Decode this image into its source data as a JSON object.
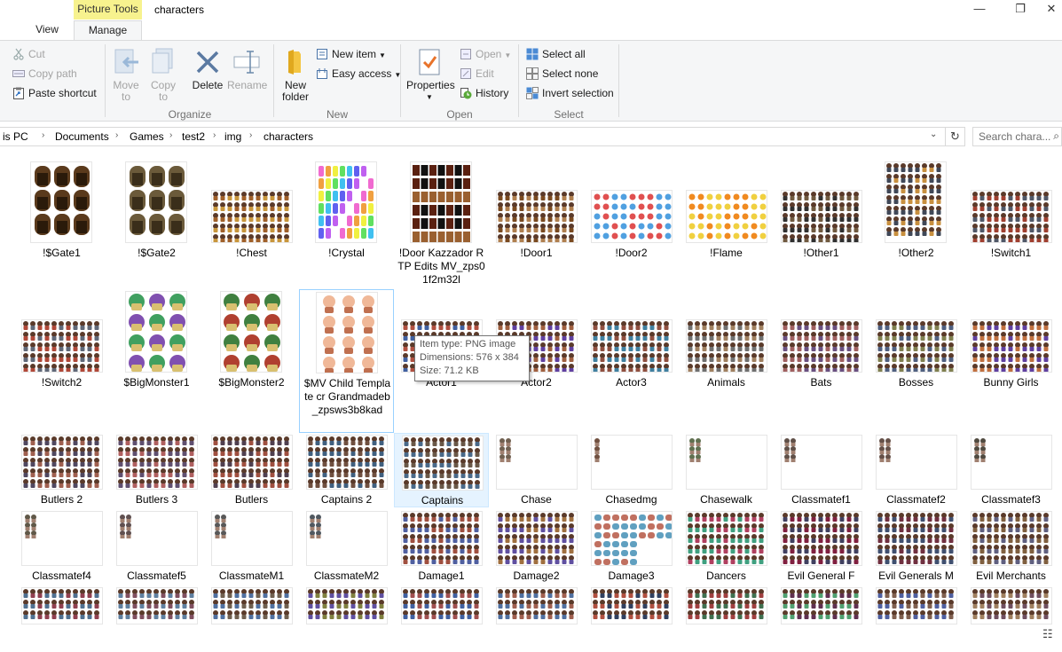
{
  "window": {
    "title": "characters",
    "context_tab_header": "Picture Tools",
    "controls": [
      "—",
      "❐",
      "✕"
    ]
  },
  "tabs": [
    {
      "label": "View"
    },
    {
      "label": "Manage"
    }
  ],
  "ribbon": {
    "clipboard": {
      "cut": "Cut",
      "copy_path": "Copy path",
      "paste_shortcut": "Paste shortcut"
    },
    "organize": {
      "label": "Organize",
      "move_to": "Move\nto",
      "copy_to": "Copy\nto",
      "delete": "Delete",
      "rename": "Rename"
    },
    "new": {
      "label": "New",
      "new_folder": "New\nfolder",
      "new_item": "New item",
      "easy_access": "Easy access"
    },
    "open": {
      "label": "Open",
      "properties": "Properties",
      "open": "Open",
      "edit": "Edit",
      "history": "History"
    },
    "select": {
      "label": "Select",
      "select_all": "Select all",
      "select_none": "Select none",
      "invert": "Invert selection"
    }
  },
  "address": {
    "crumbs": [
      "is PC",
      "Documents",
      "Games",
      "test2",
      "img",
      "characters"
    ],
    "search_placeholder": "Search chara..."
  },
  "tooltip": {
    "type": "Item type: PNG image",
    "dimensions": "Dimensions: 576 x 384",
    "size": "Size: 71.2 KB"
  },
  "files": [
    {
      "name": "!$Gate1",
      "style": "gate",
      "c1": "#5a3a1c",
      "c2": "#2a1a0a"
    },
    {
      "name": "!$Gate2",
      "style": "gate",
      "c1": "#6b5a3a",
      "c2": "#3a2e1a"
    },
    {
      "name": "!Chest",
      "style": "grid",
      "c1": "#a0602a",
      "c2": "#c8963c"
    },
    {
      "name": "!Crystal",
      "style": "crystal",
      "c1": "#f06ad0",
      "c2": "#6ad0f0"
    },
    {
      "name": "!Door Kazzador RTP Edits MV_zps01f2m32l",
      "style": "door",
      "c1": "#5a2010",
      "c2": "#9a6030"
    },
    {
      "name": "!Door1",
      "style": "grid",
      "c1": "#7a4a20",
      "c2": "#b08050"
    },
    {
      "name": "!Door2",
      "style": "dots",
      "c1": "#e05050",
      "c2": "#50a0e0"
    },
    {
      "name": "!Flame",
      "style": "dots",
      "c1": "#f08a20",
      "c2": "#f0d040"
    },
    {
      "name": "!Other1",
      "style": "grid",
      "c1": "#705a40",
      "c2": "#303030"
    },
    {
      "name": "!Other2",
      "style": "grid",
      "c1": "#c89040",
      "c2": "#404858"
    },
    {
      "name": "!Switch1",
      "style": "grid",
      "c1": "#505868",
      "c2": "#a04030"
    },
    {
      "name": "!Switch2",
      "style": "grid",
      "c1": "#606878",
      "c2": "#b04838"
    },
    {
      "name": "$BigMonster1",
      "style": "monster",
      "c1": "#8050b0",
      "c2": "#40a060"
    },
    {
      "name": "$BigMonster2",
      "style": "monster",
      "c1": "#b04030",
      "c2": "#408040"
    },
    {
      "name": "$MV Child Template cr Grandmadeb_zpsws3b8kad",
      "style": "child",
      "c1": "#e0a080",
      "c2": "#c07050"
    },
    {
      "name": "Actor1",
      "style": "sprites",
      "c1": "#b05040",
      "c2": "#4060a0"
    },
    {
      "name": "Actor2",
      "style": "sprites",
      "c1": "#a06040",
      "c2": "#6040a0"
    },
    {
      "name": "Actor3",
      "style": "sprites",
      "c1": "#905040",
      "c2": "#4080a0"
    },
    {
      "name": "Animals",
      "style": "sprites",
      "c1": "#a08060",
      "c2": "#707070"
    },
    {
      "name": "Bats",
      "style": "sprites",
      "c1": "#6a5080",
      "c2": "#a06060"
    },
    {
      "name": "Bosses",
      "style": "sprites",
      "c1": "#506080",
      "c2": "#808050"
    },
    {
      "name": "Bunny Girls",
      "style": "sprites",
      "c1": "#6040a0",
      "c2": "#c07040"
    },
    {
      "name": "Butlers 2",
      "style": "sprites",
      "c1": "#504860",
      "c2": "#a06050"
    },
    {
      "name": "Butlers 3",
      "style": "sprites",
      "c1": "#605070",
      "c2": "#b06060"
    },
    {
      "name": "Butlers",
      "style": "sprites",
      "c1": "#504050",
      "c2": "#a05040"
    },
    {
      "name": "Captains 2",
      "style": "sprites",
      "c1": "#705040",
      "c2": "#406080"
    },
    {
      "name": "Captains",
      "style": "sprites",
      "c1": "#6a5848",
      "c2": "#4a6a8a"
    },
    {
      "name": "Chase",
      "style": "sparse",
      "c1": "#706050",
      "c2": "#a08070"
    },
    {
      "name": "Chasedmg",
      "style": "sparse1",
      "c1": "#705040",
      "c2": "#a08070"
    },
    {
      "name": "Chasewalk",
      "style": "sparse",
      "c1": "#607050",
      "c2": "#a08070"
    },
    {
      "name": "Classmatef1",
      "style": "sparse",
      "c1": "#605048",
      "c2": "#a08070"
    },
    {
      "name": "Classmatef2",
      "style": "sparse",
      "c1": "#655048",
      "c2": "#a08070"
    },
    {
      "name": "Classmatef3",
      "style": "sparse",
      "c1": "#504a40",
      "c2": "#a08070"
    },
    {
      "name": "Classmatef4",
      "style": "sparse",
      "c1": "#605848",
      "c2": "#a08070"
    },
    {
      "name": "Classmatef5",
      "style": "sparse",
      "c1": "#605050",
      "c2": "#a08070"
    },
    {
      "name": "ClassmateM1",
      "style": "sparse",
      "c1": "#585858",
      "c2": "#a08070"
    },
    {
      "name": "ClassmateM2",
      "style": "sparse",
      "c1": "#505860",
      "c2": "#a08070"
    },
    {
      "name": "Damage1",
      "style": "sprites",
      "c1": "#a05040",
      "c2": "#5060a0"
    },
    {
      "name": "Damage2",
      "style": "sprites",
      "c1": "#a07040",
      "c2": "#6050a0"
    },
    {
      "name": "Damage3",
      "style": "damage3",
      "c1": "#c07060",
      "c2": "#60a0c0"
    },
    {
      "name": "Dancers",
      "style": "sprites",
      "c1": "#b04060",
      "c2": "#40a080"
    },
    {
      "name": "Evil General F",
      "style": "sprites",
      "c1": "#802040",
      "c2": "#404060"
    },
    {
      "name": "Evil Generals M",
      "style": "sprites",
      "c1": "#703040",
      "c2": "#405070"
    },
    {
      "name": "Evil Merchants",
      "style": "sprites",
      "c1": "#806040",
      "c2": "#606080"
    },
    {
      "name": "",
      "style": "sprites",
      "c1": "#904050",
      "c2": "#507090"
    },
    {
      "name": "",
      "style": "sprites",
      "c1": "#805060",
      "c2": "#6080a0"
    },
    {
      "name": "",
      "style": "sprites",
      "c1": "#706050",
      "c2": "#5070a0"
    },
    {
      "name": "",
      "style": "sprites",
      "c1": "#808040",
      "c2": "#6050a0"
    },
    {
      "name": "",
      "style": "sprites",
      "c1": "#a05050",
      "c2": "#4060a0"
    },
    {
      "name": "",
      "style": "sprites",
      "c1": "#a06050",
      "c2": "#5070a0"
    },
    {
      "name": "",
      "style": "sprites",
      "c1": "#304060",
      "c2": "#b05040"
    },
    {
      "name": "",
      "style": "sprites",
      "c1": "#407050",
      "c2": "#a04040"
    },
    {
      "name": "",
      "style": "sprites",
      "c1": "#603050",
      "c2": "#50a070"
    },
    {
      "name": "",
      "style": "sprites",
      "c1": "#806050",
      "c2": "#5060a0"
    },
    {
      "name": "",
      "style": "sprites",
      "c1": "#705060",
      "c2": "#a08060"
    }
  ]
}
